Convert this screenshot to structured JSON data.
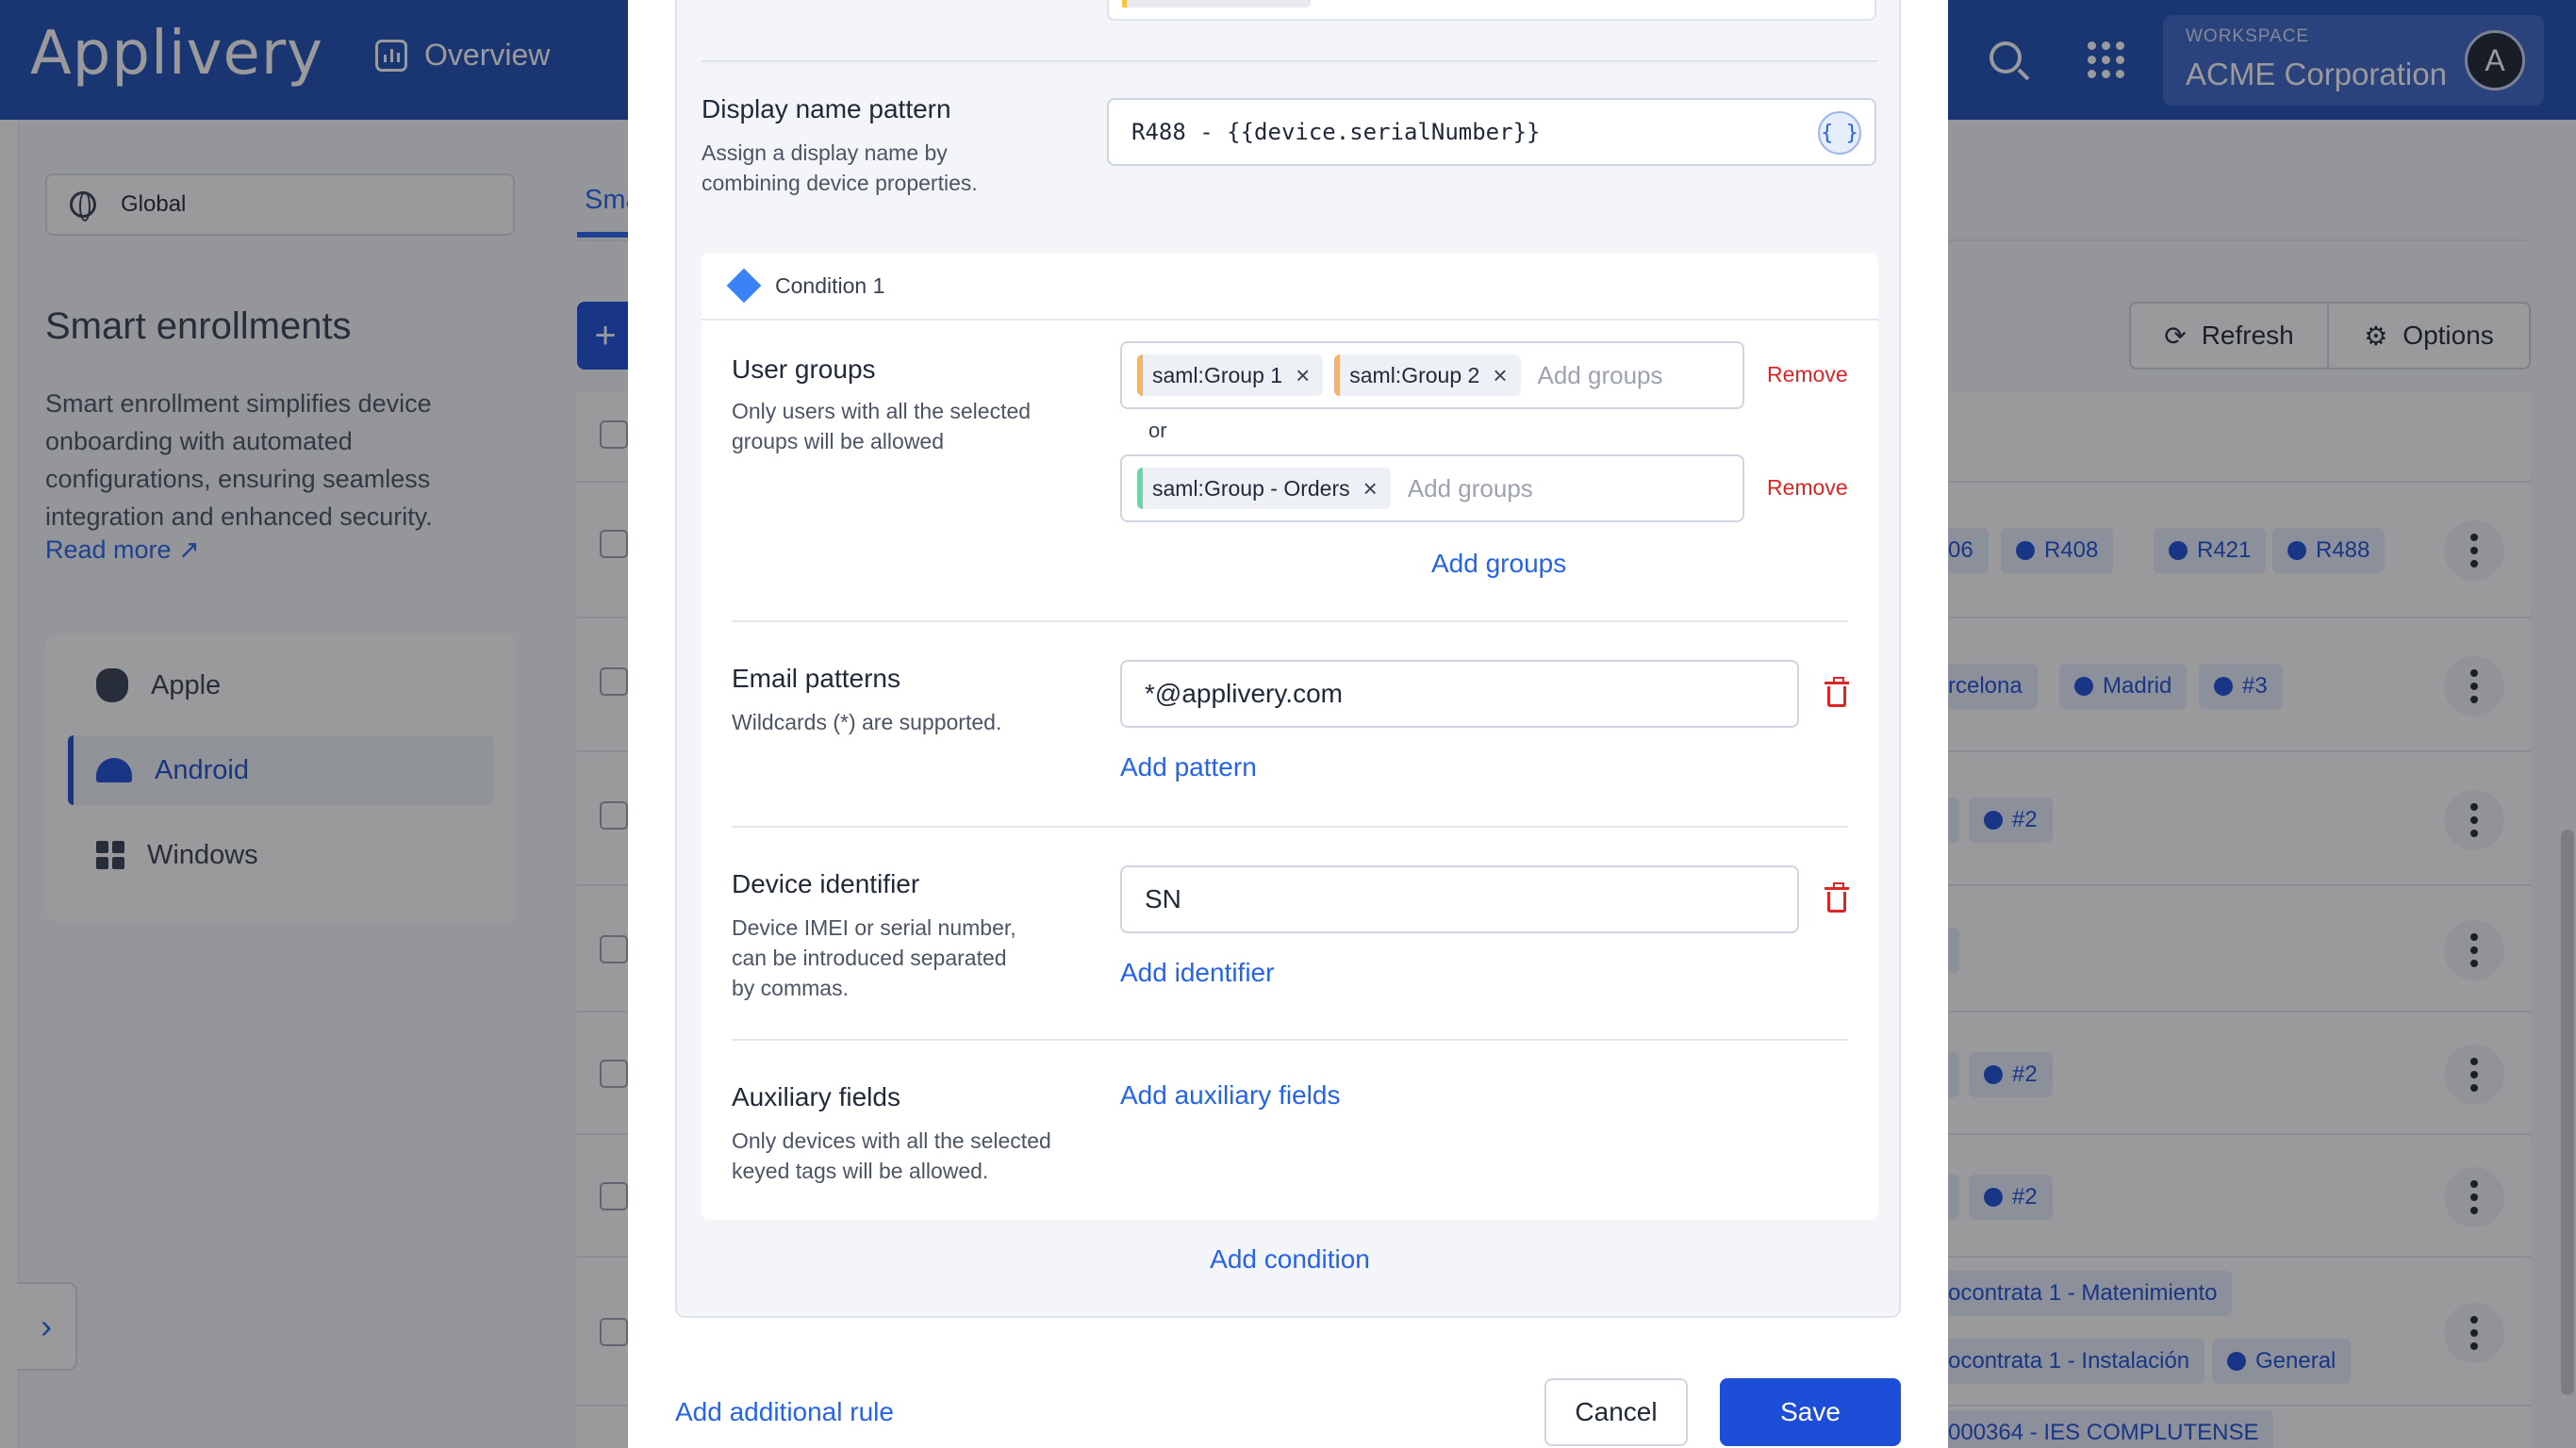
{
  "header": {
    "logo": "Applivery",
    "overview_label": "Overview",
    "workspace_label": "WORKSPACE",
    "workspace_name": "ACME Corporation",
    "avatar_letter": "A"
  },
  "sidebar": {
    "scope": "Global",
    "title": "Smart enrollments",
    "description": "Smart enrollment simplifies device onboarding with automated configurations, ensuring seamless integration and enhanced security.",
    "read_more": "Read more",
    "platforms": [
      {
        "label": "Apple",
        "icon": "apple-icon"
      },
      {
        "label": "Android",
        "icon": "android-icon",
        "active": true
      },
      {
        "label": "Windows",
        "icon": "windows-icon"
      }
    ]
  },
  "main": {
    "tab_partial": "Sma",
    "refresh_label": "Refresh",
    "options_label": "Options",
    "rows": [
      {
        "chips": [
          "06",
          "R408",
          "R421",
          "R488"
        ]
      },
      {
        "chips": [
          "rcelona",
          "Madrid",
          "#3"
        ]
      },
      {
        "chips": [
          "#2"
        ]
      },
      {
        "chips": []
      },
      {
        "chips": [
          "#2"
        ]
      },
      {
        "chips": [
          "#2"
        ]
      },
      {
        "chips": [
          "ocontrata 1 - Matenimiento",
          "ocontrata 1 - Instalación",
          "General"
        ]
      },
      {
        "chips": [
          "000364 - IES COMPLUTENSE"
        ]
      }
    ]
  },
  "modal": {
    "display_name": {
      "label": "Display name pattern",
      "description": "Assign a display name by combining device properties.",
      "value": "R488 - {{device.serialNumber}}",
      "braces": "{ }"
    },
    "condition": {
      "title": "Condition 1",
      "user_groups": {
        "label": "User groups",
        "description": "Only users with all the selected groups will be allowed",
        "group_sets": [
          {
            "tags": [
              "saml:Group 1",
              "saml:Group 2"
            ]
          },
          {
            "tags": [
              "saml:Group - Orders"
            ]
          }
        ],
        "placeholder": "Add groups",
        "or_label": "or",
        "remove_label": "Remove",
        "add_groups": "Add groups"
      },
      "email": {
        "label": "Email patterns",
        "description": "Wildcards (*) are supported.",
        "value": "*@applivery.com",
        "add_label": "Add pattern"
      },
      "device_identifier": {
        "label": "Device identifier",
        "description": "Device IMEI or serial number, can be introduced separated by commas.",
        "value": "SN",
        "add_label": "Add identifier"
      },
      "auxiliary": {
        "label": "Auxiliary fields",
        "description": "Only devices with all the selected keyed tags will be allowed.",
        "add_label": "Add auxiliary fields"
      }
    },
    "add_condition": "Add condition",
    "add_rule": "Add additional rule",
    "cancel": "Cancel",
    "save": "Save"
  }
}
